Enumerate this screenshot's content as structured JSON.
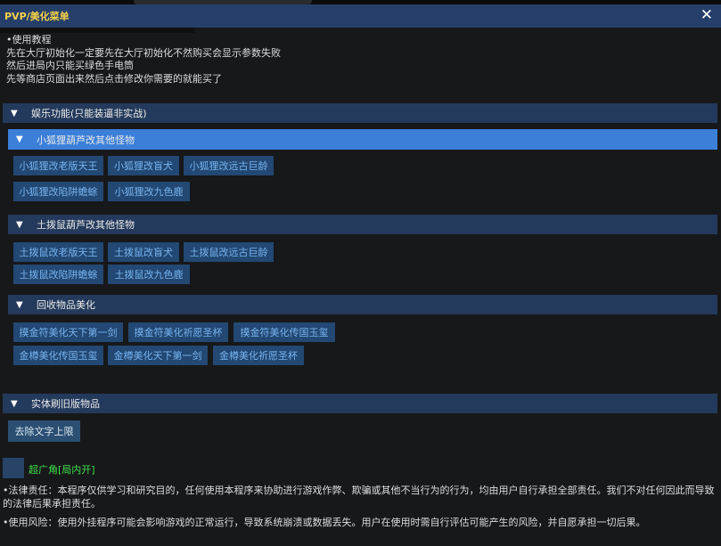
{
  "window": {
    "title": "PVP/美化菜单",
    "close_glyph": "✕"
  },
  "intro": [
    "•使用教程",
    "先在大厅初始化一定要先在大厅初始化不然购买会显示参数失败",
    "然后进局内只能买绿色手电筒",
    "先等商店页面出来然后点击修改你需要的就能买了"
  ],
  "sections": {
    "entertainment": {
      "arrow": "▼",
      "label": "娱乐功能(只能装逼非实战)"
    },
    "fox": {
      "arrow": "▼",
      "label": "小狐狸葫芦改其他怪物",
      "row1": [
        "小狐狸改老版天王",
        "小狐狸改盲犬",
        "小狐狸改远古巨龄"
      ],
      "row2": [
        "小狐狸改陷阱蟾蜍",
        "小狐狸改九色鹿"
      ]
    },
    "mole": {
      "arrow": "▼",
      "label": "土拨鼠葫芦改其他怪物",
      "row1": [
        "土拨鼠改老版天王",
        "土拨鼠改盲犬",
        "土拨鼠改远古巨龄"
      ],
      "row2": [
        "土拨鼠改陷阱蟾蜍",
        "土拨鼠改九色鹿"
      ]
    },
    "recycle": {
      "arrow": "▼",
      "label": "回收物品美化",
      "row1": [
        "摸金符美化天下第一剑",
        "摸金符美化祈愿圣杯",
        "摸金符美化传国玉玺"
      ],
      "row2": [
        "金樽美化传国玉玺",
        "金樽美化天下第一剑",
        "金樽美化祈愿圣杯"
      ]
    },
    "real": {
      "arrow": "▼",
      "label": "实体刷旧版物品",
      "button": "去除文字上限"
    }
  },
  "wide_angle": {
    "label": "超广角[局内开]"
  },
  "legal": {
    "line1": "•法律责任：本程序仅供学习和研究目的，任何使用本程序来协助进行游戏作弊、欺骗或其他不当行为的行为，均由用户自行承担全部责任。我们不对任何因此而导致的法律后果承担责任。",
    "line2": "•使用风险：使用外挂程序可能会影响游戏的正常运行，导致系统崩溃或数据丢失。用户在使用时需自行评估可能产生的风险，并自愿承担一切后果。"
  },
  "colors": {
    "title": "#f5d24a",
    "header": "#243a5c",
    "header_active": "#3b7fd9",
    "button": "#224873",
    "button_text": "#78b4ef",
    "checkbox_label": "#3ee04a"
  },
  "icons": {
    "collapse": "triangle-down-icon",
    "close": "close-icon"
  }
}
